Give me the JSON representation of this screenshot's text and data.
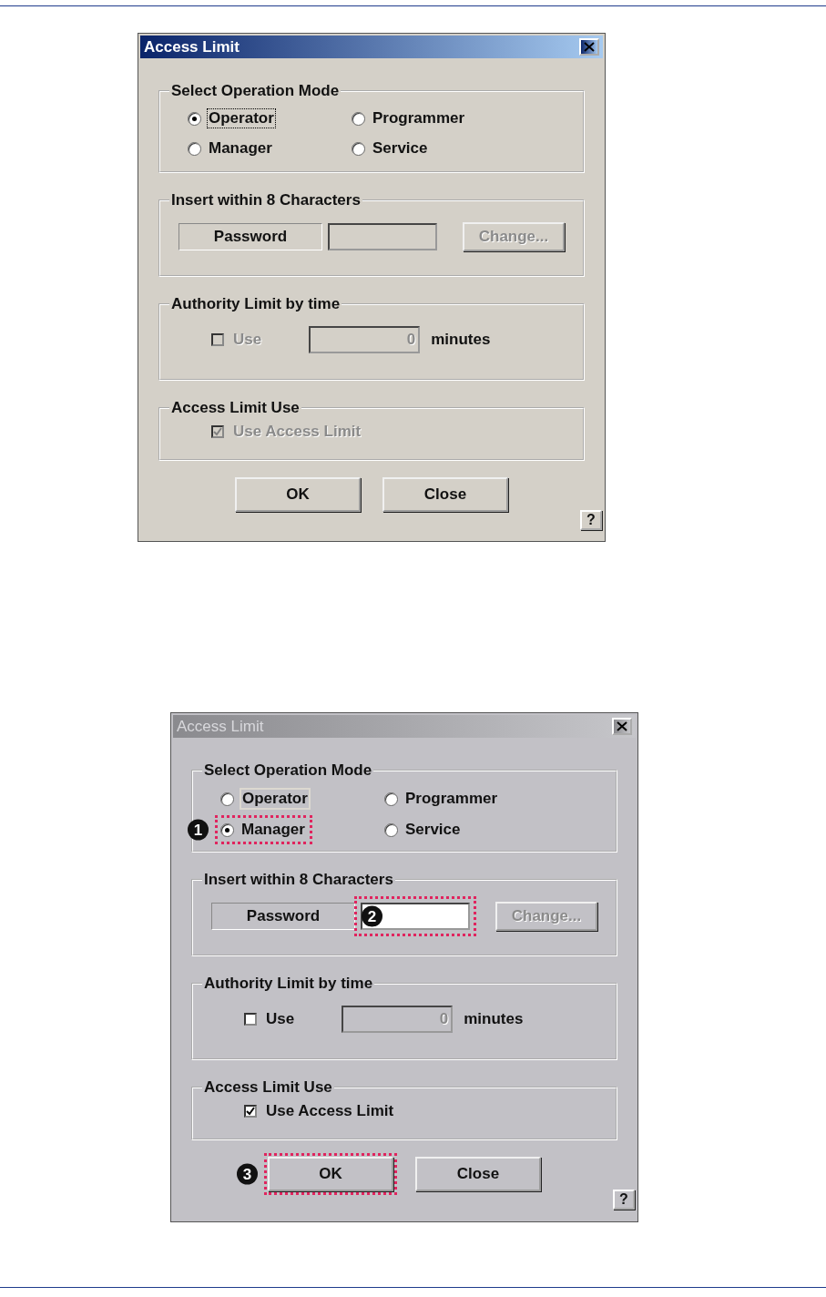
{
  "dialogs": [
    {
      "title": "Access Limit",
      "active": true,
      "mode_group": {
        "legend": "Select Operation Mode",
        "options": [
          {
            "label": "Operator",
            "selected": true,
            "focused": true
          },
          {
            "label": "Programmer",
            "selected": false,
            "focused": false
          },
          {
            "label": "Manager",
            "selected": false,
            "focused": false
          },
          {
            "label": "Service",
            "selected": false,
            "focused": false
          }
        ]
      },
      "password_group": {
        "legend": "Insert within 8 Characters",
        "label": "Password",
        "field_active": false,
        "change_button": {
          "label": "Change...",
          "disabled": true
        }
      },
      "time_group": {
        "legend": "Authority Limit by time",
        "use": {
          "label": "Use",
          "checked": false,
          "disabled": true
        },
        "minutes_value": "0",
        "unit": "minutes"
      },
      "access_group": {
        "legend": "Access Limit Use",
        "use": {
          "label": "Use Access Limit",
          "checked": true,
          "disabled": true
        }
      },
      "buttons": [
        {
          "label": "OK"
        },
        {
          "label": "Close"
        }
      ],
      "help": "?"
    },
    {
      "title": "Access Limit",
      "active": false,
      "mode_group": {
        "legend": "Select Operation Mode",
        "options": [
          {
            "label": "Operator",
            "selected": false,
            "focused": true
          },
          {
            "label": "Programmer",
            "selected": false,
            "focused": false
          },
          {
            "label": "Manager",
            "selected": true,
            "focused": false,
            "callout": "1"
          },
          {
            "label": "Service",
            "selected": false,
            "focused": false
          }
        ]
      },
      "password_group": {
        "legend": "Insert within 8 Characters",
        "label": "Password",
        "field_active": true,
        "callout": "2",
        "change_button": {
          "label": "Change...",
          "disabled": true
        }
      },
      "time_group": {
        "legend": "Authority Limit by time",
        "use": {
          "label": "Use",
          "checked": false,
          "disabled": false
        },
        "minutes_value": "0",
        "unit": "minutes"
      },
      "access_group": {
        "legend": "Access Limit Use",
        "use": {
          "label": "Use Access Limit",
          "checked": true,
          "disabled": false
        }
      },
      "buttons": [
        {
          "label": "OK",
          "callout": "3"
        },
        {
          "label": "Close"
        }
      ],
      "help": "?"
    }
  ]
}
